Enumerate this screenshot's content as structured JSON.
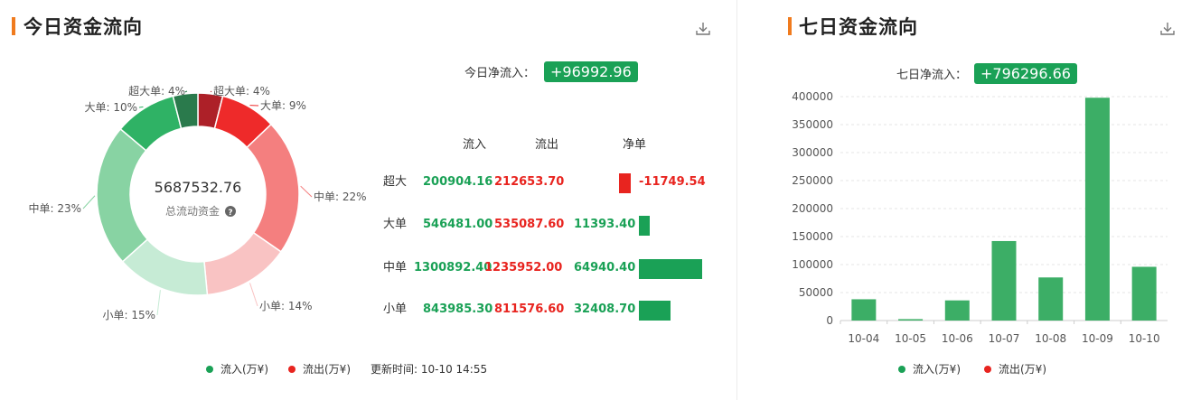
{
  "left": {
    "title": "今日资金流向",
    "net_label": "今日净流入：",
    "net_value": "+96992.96",
    "center_value": "5687532.76",
    "center_label": "总流动资金",
    "table_headers": [
      "流入",
      "流出",
      "净单"
    ],
    "table_rows": [
      {
        "name": "超大",
        "inflow": "200904.16",
        "outflow": "212653.70",
        "net": "-11749.54",
        "net_num": -11749.54
      },
      {
        "name": "大单",
        "inflow": "546481.00",
        "outflow": "535087.60",
        "net": "11393.40",
        "net_num": 11393.4
      },
      {
        "name": "中单",
        "inflow": "1300892.40",
        "outflow": "1235952.00",
        "net": "64940.40",
        "net_num": 64940.4
      },
      {
        "name": "小单",
        "inflow": "843985.30",
        "outflow": "811576.60",
        "net": "32408.70",
        "net_num": 32408.7
      }
    ],
    "legend": {
      "inflow": "流入(万¥)",
      "outflow": "流出(万¥)"
    },
    "update_time": "更新时间: 10-10 14:55"
  },
  "right": {
    "title": "七日资金流向",
    "net_label": "七日净流入：",
    "net_value": "+796296.66",
    "legend": {
      "inflow": "流入(万¥)",
      "outflow": "流出(万¥)"
    }
  },
  "colors": {
    "green": "#1aa156",
    "red": "#e8241f",
    "accent": "#f07b1e",
    "bar_green": "#3cae66"
  },
  "chart_data": [
    {
      "type": "pie",
      "subtype": "donut",
      "slices": [
        {
          "label": "超大单: 4%",
          "percent": 4,
          "color": "#ad2028",
          "flow": "outflow"
        },
        {
          "label": "大单: 9%",
          "percent": 9,
          "color": "#ee2a2a",
          "flow": "outflow"
        },
        {
          "label": "中单: 22%",
          "percent": 22,
          "color": "#f47f7f",
          "flow": "outflow"
        },
        {
          "label": "小单: 14%",
          "percent": 14,
          "color": "#f9c3c3",
          "flow": "outflow"
        },
        {
          "label": "小单: 15%",
          "percent": 15,
          "color": "#c6ebd5",
          "flow": "inflow"
        },
        {
          "label": "中单: 23%",
          "percent": 23,
          "color": "#88d3a3",
          "flow": "inflow"
        },
        {
          "label": "大单: 10%",
          "percent": 10,
          "color": "#2fb265",
          "flow": "inflow"
        },
        {
          "label": "超大单: 4%",
          "percent": 4,
          "color": "#2a7a4c",
          "flow": "inflow"
        }
      ]
    },
    {
      "type": "bar",
      "categories": [
        "10-04",
        "10-05",
        "10-06",
        "10-07",
        "10-08",
        "10-09",
        "10-10"
      ],
      "values": [
        38000,
        2500,
        36000,
        142000,
        77000,
        398000,
        96000
      ],
      "ylim": [
        0,
        400000
      ],
      "yticks": [
        "0",
        "50000",
        "100000",
        "150000",
        "200000",
        "250000",
        "300000",
        "350000",
        "400000"
      ],
      "grid": true
    }
  ]
}
